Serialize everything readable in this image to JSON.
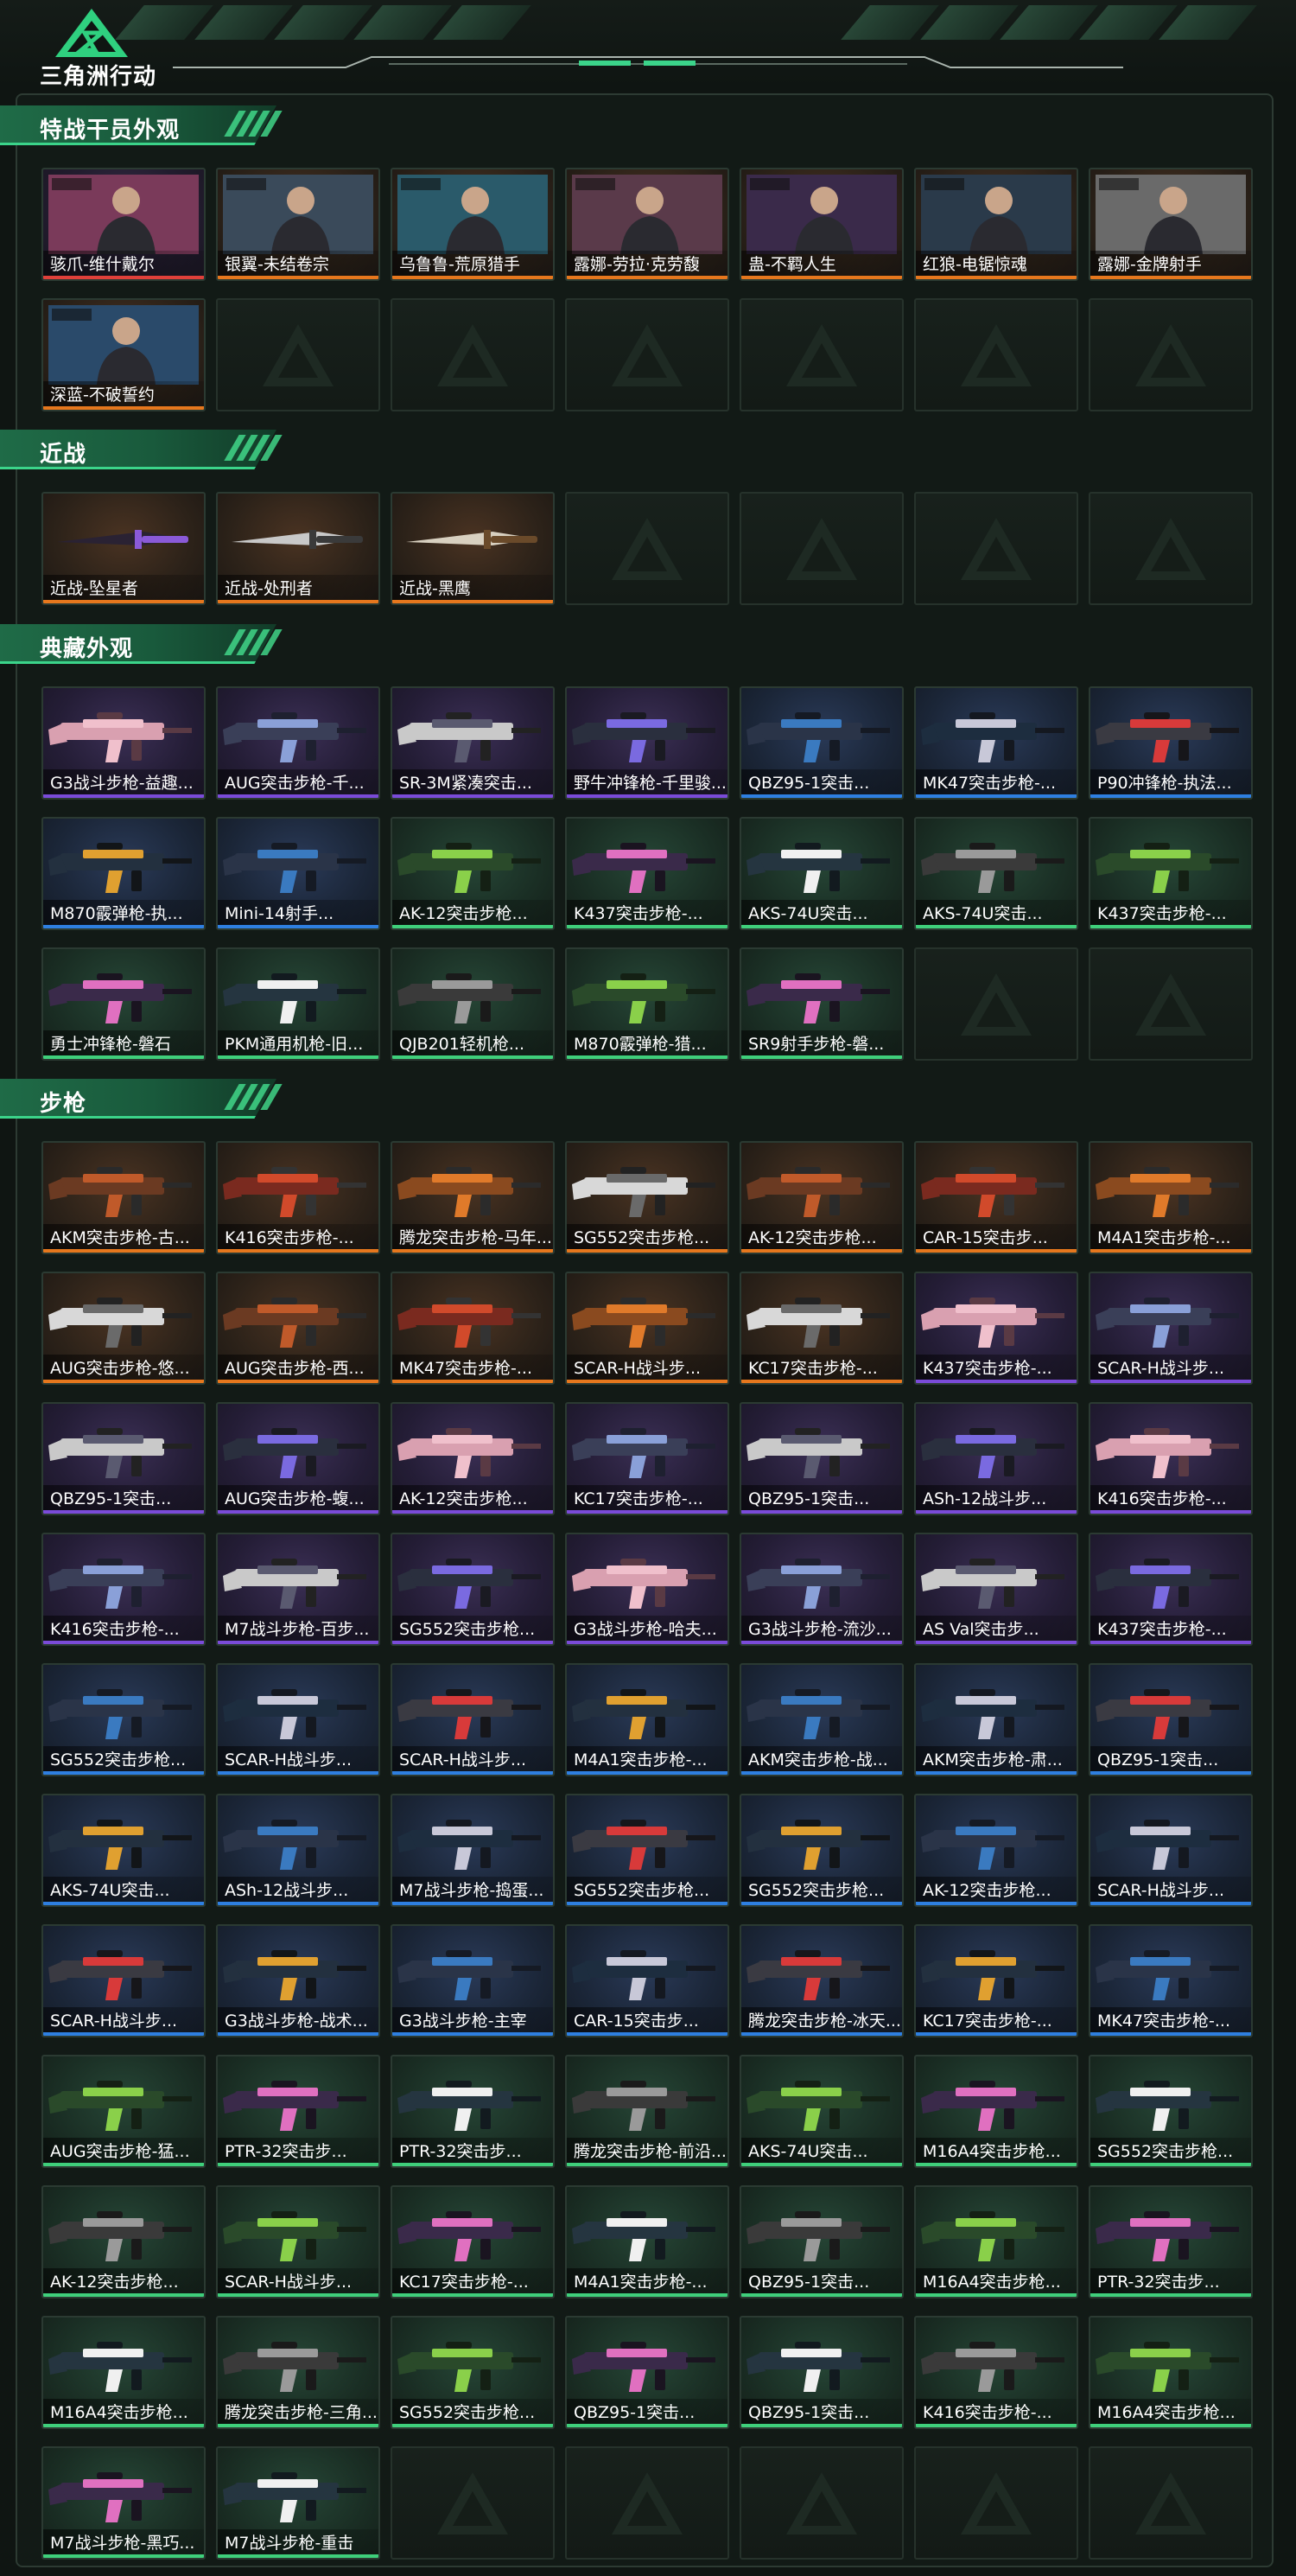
{
  "app": {
    "title": "三角洲行动"
  },
  "sections": [
    {
      "title": "特战干员外观",
      "items": [
        {
          "label": "骇爪-维什戴尔",
          "rarity": "red",
          "kind": "operator"
        },
        {
          "label": "银翼-未结卷宗",
          "rarity": "orange",
          "kind": "operator"
        },
        {
          "label": "乌鲁鲁-荒原猎手",
          "rarity": "orange",
          "kind": "operator"
        },
        {
          "label": "露娜-劳拉·克劳馥",
          "rarity": "orange",
          "kind": "operator"
        },
        {
          "label": "蛊-不羁人生",
          "rarity": "orange",
          "kind": "operator"
        },
        {
          "label": "红狼-电锯惊魂",
          "rarity": "orange",
          "kind": "operator"
        },
        {
          "label": "露娜-金牌射手",
          "rarity": "orange",
          "kind": "operator"
        },
        {
          "label": "深蓝-不破誓约",
          "rarity": "orange",
          "kind": "operator"
        }
      ],
      "empty_slots": 6
    },
    {
      "title": "近战",
      "items": [
        {
          "label": "近战-坠星者",
          "rarity": "orange",
          "kind": "melee"
        },
        {
          "label": "近战-处刑者",
          "rarity": "orange",
          "kind": "melee"
        },
        {
          "label": "近战-黑鹰",
          "rarity": "orange",
          "kind": "melee"
        }
      ],
      "empty_slots": 4
    },
    {
      "title": "典藏外观",
      "items": [
        {
          "label": "G3战斗步枪-益趣...",
          "rarity": "purple",
          "kind": "gun"
        },
        {
          "label": "AUG突击步枪-千...",
          "rarity": "purple",
          "kind": "gun"
        },
        {
          "label": "SR-3M紧凑突击...",
          "rarity": "purple",
          "kind": "gun"
        },
        {
          "label": "野牛冲锋枪-千里骏...",
          "rarity": "purple",
          "kind": "gun"
        },
        {
          "label": "QBZ95-1突击...",
          "rarity": "blue",
          "kind": "gun"
        },
        {
          "label": "MK47突击步枪-...",
          "rarity": "blue",
          "kind": "gun"
        },
        {
          "label": "P90冲锋枪-执法...",
          "rarity": "blue",
          "kind": "gun"
        },
        {
          "label": "M870霰弹枪-执...",
          "rarity": "blue",
          "kind": "gun"
        },
        {
          "label": "Mini-14射手...",
          "rarity": "blue",
          "kind": "gun"
        },
        {
          "label": "AK-12突击步枪...",
          "rarity": "green",
          "kind": "gun"
        },
        {
          "label": "K437突击步枪-...",
          "rarity": "green",
          "kind": "gun"
        },
        {
          "label": "AKS-74U突击...",
          "rarity": "green",
          "kind": "gun"
        },
        {
          "label": "AKS-74U突击...",
          "rarity": "green",
          "kind": "gun"
        },
        {
          "label": "K437突击步枪-...",
          "rarity": "green",
          "kind": "gun"
        },
        {
          "label": "勇士冲锋枪-磐石",
          "rarity": "green",
          "kind": "gun"
        },
        {
          "label": "PKM通用机枪-旧...",
          "rarity": "green",
          "kind": "gun"
        },
        {
          "label": "QJB201轻机枪...",
          "rarity": "green",
          "kind": "gun"
        },
        {
          "label": "M870霰弹枪-猎...",
          "rarity": "green",
          "kind": "gun"
        },
        {
          "label": "SR9射手步枪-磐...",
          "rarity": "green",
          "kind": "gun"
        }
      ],
      "empty_slots": 2
    },
    {
      "title": "步枪",
      "items": [
        {
          "label": "AKM突击步枪-古...",
          "rarity": "orange",
          "kind": "gun"
        },
        {
          "label": "K416突击步枪-...",
          "rarity": "orange",
          "kind": "gun"
        },
        {
          "label": "腾龙突击步枪-马年...",
          "rarity": "orange",
          "kind": "gun"
        },
        {
          "label": "SG552突击步枪...",
          "rarity": "orange",
          "kind": "gun"
        },
        {
          "label": "AK-12突击步枪...",
          "rarity": "orange",
          "kind": "gun"
        },
        {
          "label": "CAR-15突击步...",
          "rarity": "orange",
          "kind": "gun"
        },
        {
          "label": "M4A1突击步枪-...",
          "rarity": "orange",
          "kind": "gun"
        },
        {
          "label": "AUG突击步枪-悠...",
          "rarity": "orange",
          "kind": "gun"
        },
        {
          "label": "AUG突击步枪-西...",
          "rarity": "orange",
          "kind": "gun"
        },
        {
          "label": "MK47突击步枪-...",
          "rarity": "orange",
          "kind": "gun"
        },
        {
          "label": "SCAR-H战斗步...",
          "rarity": "orange",
          "kind": "gun"
        },
        {
          "label": "KC17突击步枪-...",
          "rarity": "orange",
          "kind": "gun"
        },
        {
          "label": "K437突击步枪-...",
          "rarity": "purple",
          "kind": "gun"
        },
        {
          "label": "SCAR-H战斗步...",
          "rarity": "purple",
          "kind": "gun"
        },
        {
          "label": "QBZ95-1突击...",
          "rarity": "purple",
          "kind": "gun"
        },
        {
          "label": "AUG突击步枪-蝮...",
          "rarity": "purple",
          "kind": "gun"
        },
        {
          "label": "AK-12突击步枪...",
          "rarity": "purple",
          "kind": "gun"
        },
        {
          "label": "KC17突击步枪-...",
          "rarity": "purple",
          "kind": "gun"
        },
        {
          "label": "QBZ95-1突击...",
          "rarity": "purple",
          "kind": "gun"
        },
        {
          "label": "ASh-12战斗步...",
          "rarity": "purple",
          "kind": "gun"
        },
        {
          "label": "K416突击步枪-...",
          "rarity": "purple",
          "kind": "gun"
        },
        {
          "label": "K416突击步枪-...",
          "rarity": "purple",
          "kind": "gun"
        },
        {
          "label": "M7战斗步枪-百步...",
          "rarity": "purple",
          "kind": "gun"
        },
        {
          "label": "SG552突击步枪...",
          "rarity": "purple",
          "kind": "gun"
        },
        {
          "label": "G3战斗步枪-哈夫...",
          "rarity": "purple",
          "kind": "gun"
        },
        {
          "label": "G3战斗步枪-流沙...",
          "rarity": "purple",
          "kind": "gun"
        },
        {
          "label": "AS Val突击步...",
          "rarity": "purple",
          "kind": "gun"
        },
        {
          "label": "K437突击步枪-...",
          "rarity": "purple",
          "kind": "gun"
        },
        {
          "label": "SG552突击步枪...",
          "rarity": "blue",
          "kind": "gun"
        },
        {
          "label": "SCAR-H战斗步...",
          "rarity": "blue",
          "kind": "gun"
        },
        {
          "label": "SCAR-H战斗步...",
          "rarity": "blue",
          "kind": "gun"
        },
        {
          "label": "M4A1突击步枪-...",
          "rarity": "blue",
          "kind": "gun"
        },
        {
          "label": "AKM突击步枪-战...",
          "rarity": "blue",
          "kind": "gun"
        },
        {
          "label": "AKM突击步枪-肃...",
          "rarity": "blue",
          "kind": "gun"
        },
        {
          "label": "QBZ95-1突击...",
          "rarity": "blue",
          "kind": "gun"
        },
        {
          "label": "AKS-74U突击...",
          "rarity": "blue",
          "kind": "gun"
        },
        {
          "label": "ASh-12战斗步...",
          "rarity": "blue",
          "kind": "gun"
        },
        {
          "label": "M7战斗步枪-捣蛋...",
          "rarity": "blue",
          "kind": "gun"
        },
        {
          "label": "SG552突击步枪...",
          "rarity": "blue",
          "kind": "gun"
        },
        {
          "label": "SG552突击步枪...",
          "rarity": "blue",
          "kind": "gun"
        },
        {
          "label": "AK-12突击步枪...",
          "rarity": "blue",
          "kind": "gun"
        },
        {
          "label": "SCAR-H战斗步...",
          "rarity": "blue",
          "kind": "gun"
        },
        {
          "label": "SCAR-H战斗步...",
          "rarity": "blue",
          "kind": "gun"
        },
        {
          "label": "G3战斗步枪-战术...",
          "rarity": "blue",
          "kind": "gun"
        },
        {
          "label": "G3战斗步枪-主宰",
          "rarity": "blue",
          "kind": "gun"
        },
        {
          "label": "CAR-15突击步...",
          "rarity": "blue",
          "kind": "gun"
        },
        {
          "label": "腾龙突击步枪-冰天...",
          "rarity": "blue",
          "kind": "gun"
        },
        {
          "label": "KC17突击步枪-...",
          "rarity": "blue",
          "kind": "gun"
        },
        {
          "label": "MK47突击步枪-...",
          "rarity": "blue",
          "kind": "gun"
        },
        {
          "label": "AUG突击步枪-猛...",
          "rarity": "green",
          "kind": "gun"
        },
        {
          "label": "PTR-32突击步...",
          "rarity": "green",
          "kind": "gun"
        },
        {
          "label": "PTR-32突击步...",
          "rarity": "green",
          "kind": "gun"
        },
        {
          "label": "腾龙突击步枪-前沿...",
          "rarity": "green",
          "kind": "gun"
        },
        {
          "label": "AKS-74U突击...",
          "rarity": "green",
          "kind": "gun"
        },
        {
          "label": "M16A4突击步枪...",
          "rarity": "green",
          "kind": "gun"
        },
        {
          "label": "SG552突击步枪...",
          "rarity": "green",
          "kind": "gun"
        },
        {
          "label": "AK-12突击步枪...",
          "rarity": "green",
          "kind": "gun"
        },
        {
          "label": "SCAR-H战斗步...",
          "rarity": "green",
          "kind": "gun"
        },
        {
          "label": "KC17突击步枪-...",
          "rarity": "green",
          "kind": "gun"
        },
        {
          "label": "M4A1突击步枪-...",
          "rarity": "green",
          "kind": "gun"
        },
        {
          "label": "QBZ95-1突击...",
          "rarity": "green",
          "kind": "gun"
        },
        {
          "label": "M16A4突击步枪...",
          "rarity": "green",
          "kind": "gun"
        },
        {
          "label": "PTR-32突击步...",
          "rarity": "green",
          "kind": "gun"
        },
        {
          "label": "M16A4突击步枪...",
          "rarity": "green",
          "kind": "gun"
        },
        {
          "label": "腾龙突击步枪-三角...",
          "rarity": "green",
          "kind": "gun"
        },
        {
          "label": "SG552突击步枪...",
          "rarity": "green",
          "kind": "gun"
        },
        {
          "label": "QBZ95-1突击...",
          "rarity": "green",
          "kind": "gun"
        },
        {
          "label": "QBZ95-1突击...",
          "rarity": "green",
          "kind": "gun"
        },
        {
          "label": "K416突击步枪-...",
          "rarity": "green",
          "kind": "gun"
        },
        {
          "label": "M16A4突击步枪...",
          "rarity": "green",
          "kind": "gun"
        },
        {
          "label": "M7战斗步枪-黑巧...",
          "rarity": "green",
          "kind": "gun"
        },
        {
          "label": "M7战斗步枪-重击",
          "rarity": "green",
          "kind": "gun"
        }
      ],
      "empty_slots": 5
    }
  ],
  "colors": {
    "accent": "#3bd48a",
    "background": "#0f1512",
    "rarity_orange": "#e6771d",
    "rarity_purple": "#7a4bd8",
    "rarity_blue": "#2e7fe0",
    "rarity_green": "#3fcf7b",
    "rarity_red": "#e0403a"
  }
}
